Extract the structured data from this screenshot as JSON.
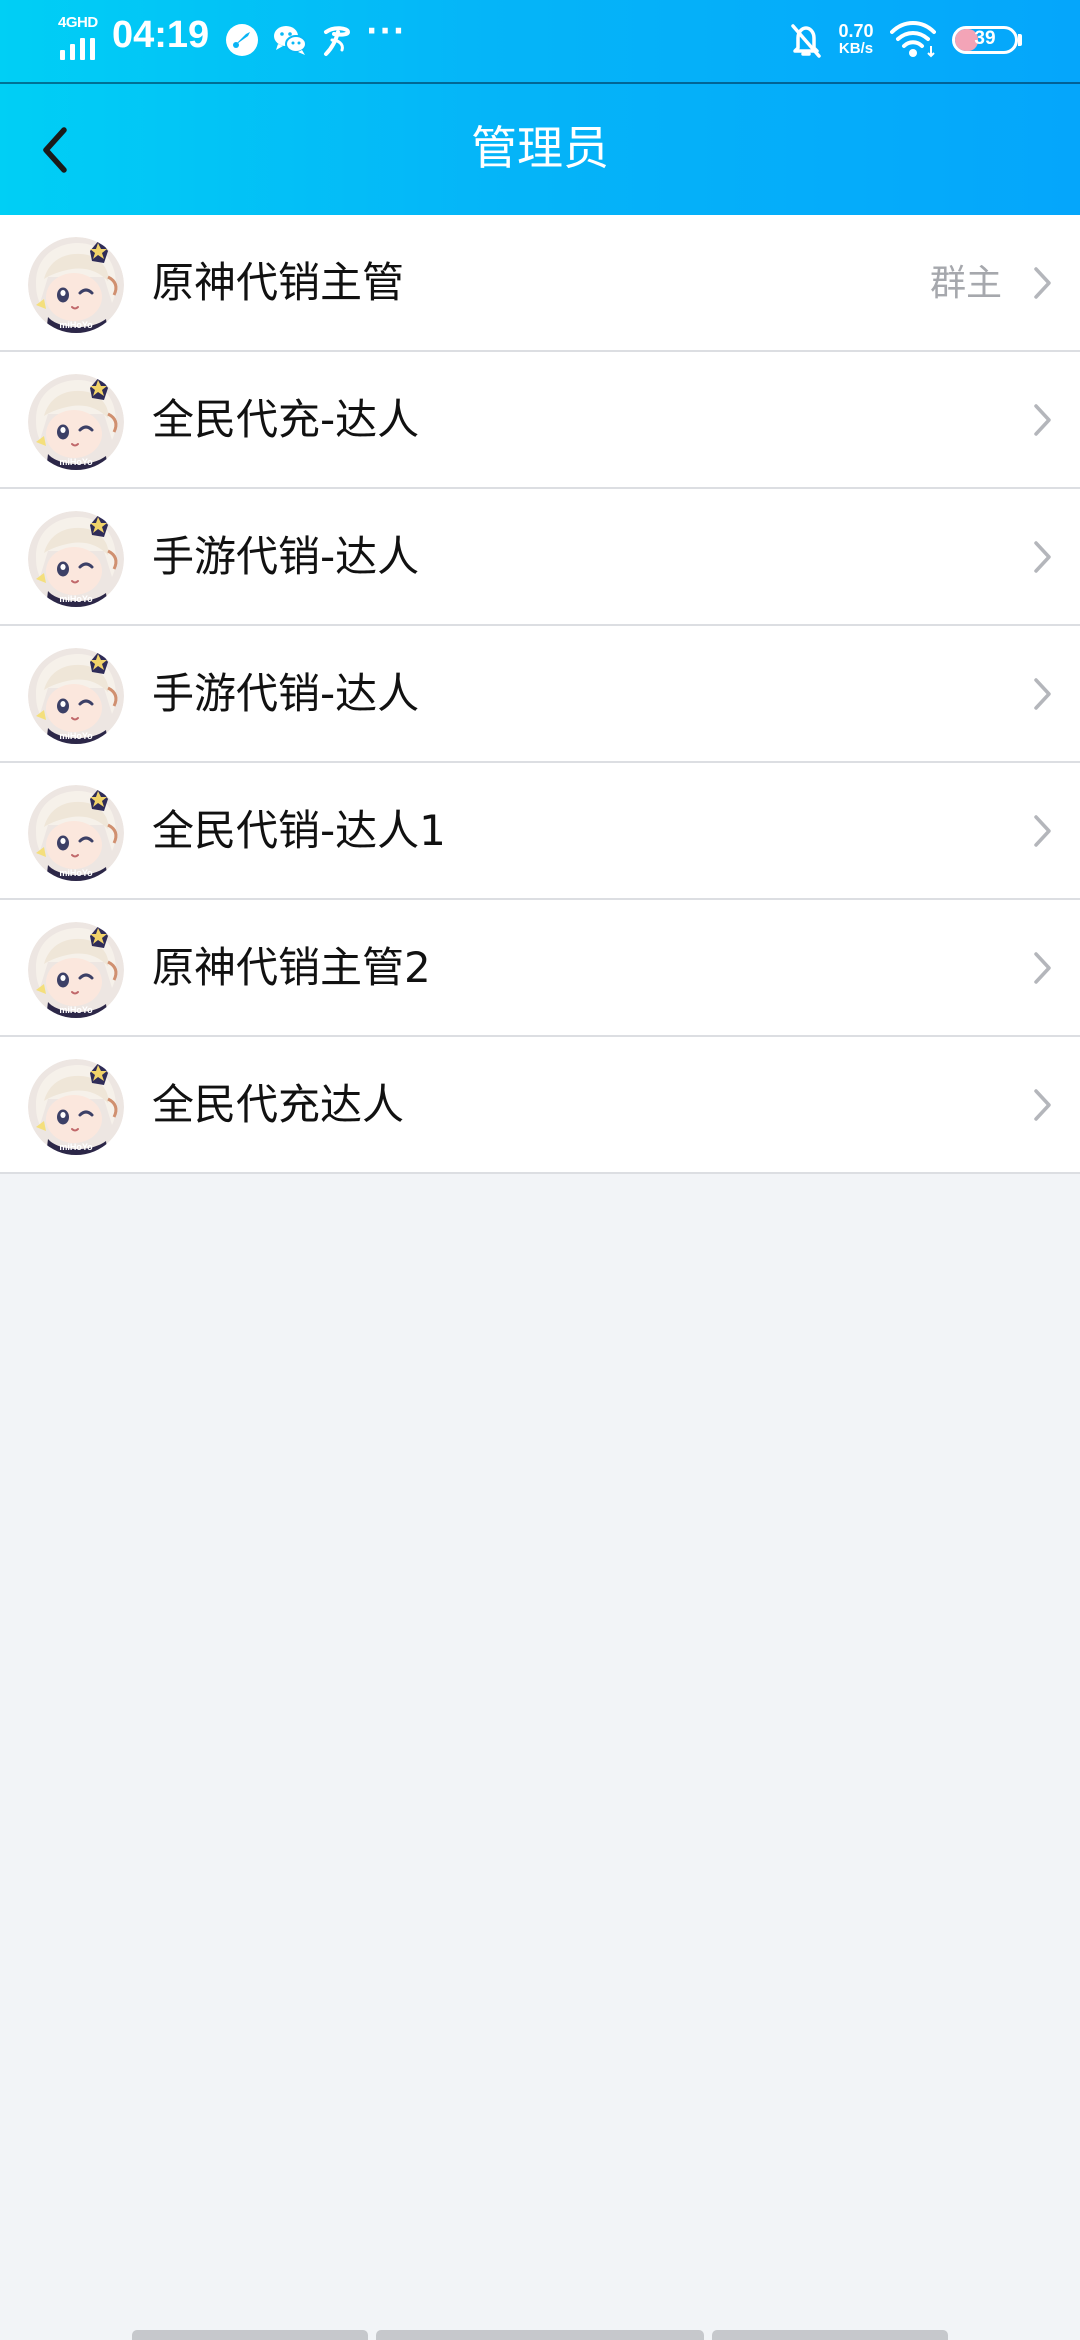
{
  "status_bar": {
    "network": "4GHD",
    "time": "04:19",
    "speed_value": "0.70",
    "speed_unit": "KB/s",
    "battery_level": "39",
    "battery_fraction": 0.39,
    "more": "···",
    "icons": [
      "signal-icon",
      "compass-icon",
      "wechat-icon",
      "telecom-icon",
      "mute-bell-icon",
      "wifi-icon",
      "battery-icon"
    ]
  },
  "header": {
    "title": "管理员",
    "back_icon": "chevron-left-icon",
    "gradient": [
      "#00cff5",
      "#05a6fb"
    ]
  },
  "admins": [
    {
      "name": "原神代销主管",
      "role": "群主"
    },
    {
      "name": "全民代充-达人",
      "role": ""
    },
    {
      "name": "手游代销-达人",
      "role": ""
    },
    {
      "name": "手游代销-达人",
      "role": ""
    },
    {
      "name": "全民代销-达人1",
      "role": ""
    },
    {
      "name": "原神代销主管2",
      "role": ""
    },
    {
      "name": "全民代充达人",
      "role": ""
    }
  ],
  "colors": {
    "page_bg": "#f2f4f7",
    "row_text": "#111111",
    "role_text": "#a6a8ad",
    "chevron": "#b4b6bb"
  }
}
